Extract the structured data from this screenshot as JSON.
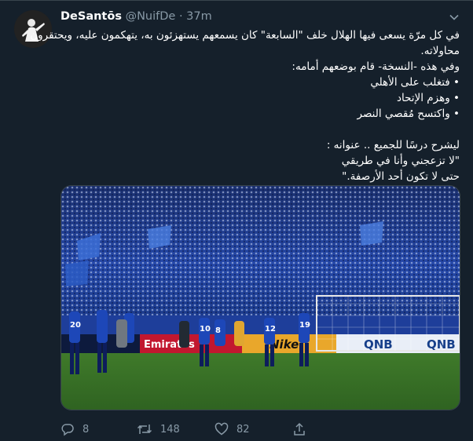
{
  "tweet": {
    "display_name": "DeSantōs",
    "handle": "@NuifDe",
    "separator": "·",
    "time": "37m",
    "body_lines": [
      "في كل مرّة يسعى فيها الهلال خلف \"السابعة\" كان يسمعهم يستهزئون به، يتهكمون عليه، ويحتقرون",
      "محاولاته.",
      "وفي هذه -النسخة- قام بوضعهم أمامه:",
      "• فتغلب على الأهلي",
      "• وهزم الإتحاد",
      "• واكتسح مُقصي النصر",
      "",
      "ليشرح درسًا للجميع .. عنوانه :",
      "\"لا تزعجني وأنا في طريقي",
      "حتى لا تكون أحد الأرصفة.\""
    ],
    "media": {
      "banner_text": "Emirates",
      "ad_text_1": "QNB",
      "ad_text_2": "QNB",
      "ad_text_3": "Nike",
      "player_numbers": [
        "20",
        "10",
        "8",
        "12",
        "19"
      ]
    },
    "actions": {
      "reply_count": "8",
      "retweet_count": "148",
      "like_count": "82"
    },
    "colors": {
      "background": "#15202b",
      "secondary_text": "#8899a6",
      "border": "#38444d"
    }
  }
}
